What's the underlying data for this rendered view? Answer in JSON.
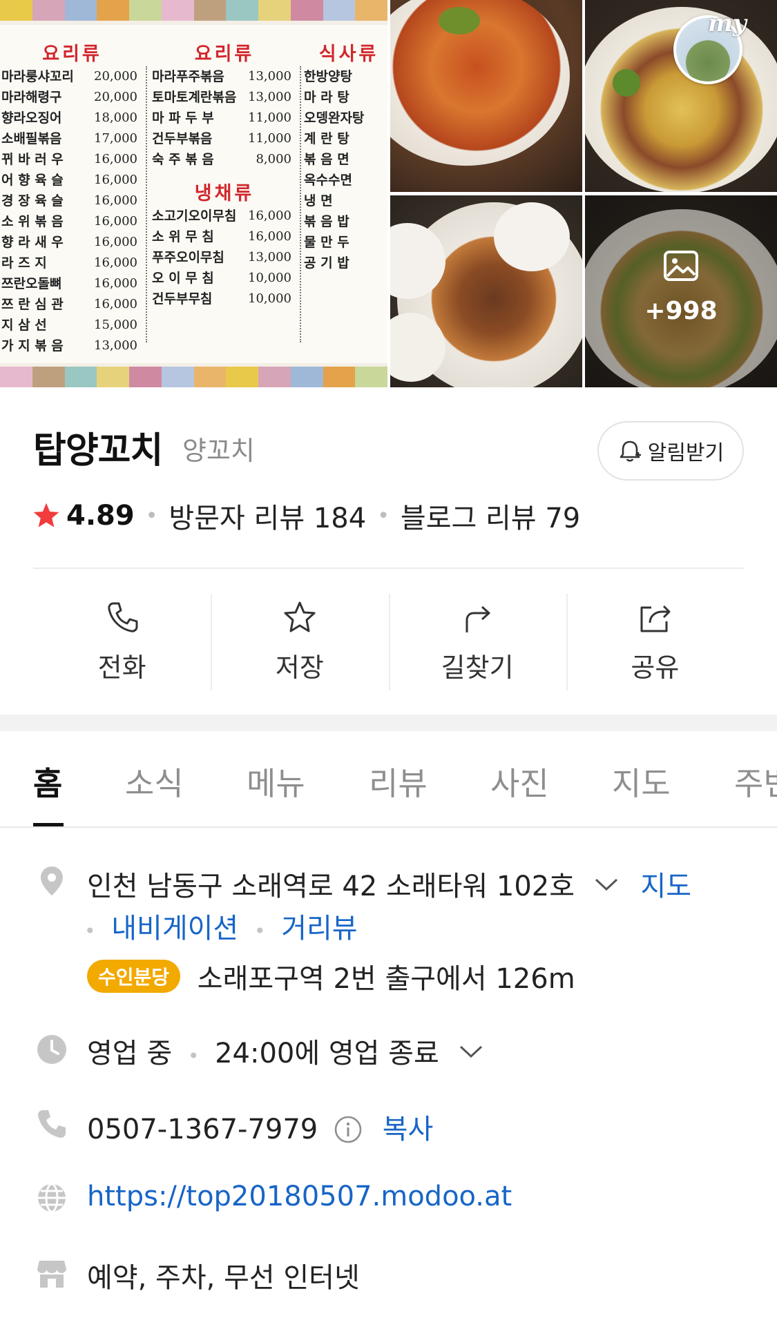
{
  "gallery": {
    "menu_board": {
      "colors": [
        "#e8c94a",
        "#d6a5b8",
        "#9fb8d8",
        "#e4a34a",
        "#c9d79a",
        "#e7b9cf",
        "#bfa07e",
        "#9ac7c2",
        "#e6d27a",
        "#cf8aa2",
        "#b7c6e0",
        "#e9b56a"
      ],
      "columns": [
        {
          "sections": [
            {
              "heading": "요리류",
              "items": [
                {
                  "name": "마라룽샤꼬리",
                  "price": "20,000"
                },
                {
                  "name": "마라해령구",
                  "price": "20,000"
                },
                {
                  "name": "향라오징어",
                  "price": "18,000"
                },
                {
                  "name": "소배필볶음",
                  "price": "17,000"
                },
                {
                  "name": "뀌 바 러 우",
                  "price": "16,000"
                },
                {
                  "name": "어 향 육 슬",
                  "price": "16,000"
                },
                {
                  "name": "경 장 육 슬",
                  "price": "16,000"
                },
                {
                  "name": "소 위 볶 음",
                  "price": "16,000"
                },
                {
                  "name": "향 라 새 우",
                  "price": "16,000"
                },
                {
                  "name": "라 즈 지",
                  "price": "16,000"
                },
                {
                  "name": "쯔란오돌뼈",
                  "price": "16,000"
                },
                {
                  "name": "쯔 란 심 관",
                  "price": "16,000"
                },
                {
                  "name": "지 삼 선",
                  "price": "15,000"
                },
                {
                  "name": "가 지 볶 음",
                  "price": "13,000"
                }
              ]
            }
          ]
        },
        {
          "sections": [
            {
              "heading": "요리류",
              "items": [
                {
                  "name": "마라푸주볶음",
                  "price": "13,000"
                },
                {
                  "name": "토마토계란볶음",
                  "price": "13,000"
                },
                {
                  "name": "마 파 두 부",
                  "price": "11,000"
                },
                {
                  "name": "건두부볶음",
                  "price": "11,000"
                },
                {
                  "name": "숙 주 볶 음",
                  "price": "8,000"
                }
              ]
            },
            {
              "heading": "냉채류",
              "items": [
                {
                  "name": "소고기오이무침",
                  "price": "16,000"
                },
                {
                  "name": "소 위 무 침",
                  "price": "16,000"
                },
                {
                  "name": "푸주오이무침",
                  "price": "13,000"
                },
                {
                  "name": "오 이 무 침",
                  "price": "10,000"
                },
                {
                  "name": "건두부무침",
                  "price": "10,000"
                }
              ]
            }
          ]
        },
        {
          "sections": [
            {
              "heading": "식사류",
              "items": [
                {
                  "name": "한방양탕",
                  "price": ""
                },
                {
                  "name": "마 라 탕",
                  "price": ""
                },
                {
                  "name": "오뎅완자탕",
                  "price": ""
                },
                {
                  "name": "계 란 탕",
                  "price": ""
                },
                {
                  "name": "볶 음 면",
                  "price": ""
                },
                {
                  "name": "옥수수면",
                  "price": ""
                },
                {
                  "name": "냉 면",
                  "price": ""
                },
                {
                  "name": "볶 음 밥",
                  "price": ""
                },
                {
                  "name": "물 만 두",
                  "price": ""
                },
                {
                  "name": "공 기 밥",
                  "price": ""
                }
              ]
            }
          ]
        }
      ]
    },
    "my_label": "my",
    "more_count": "+998",
    "more_icon": "image-icon"
  },
  "place": {
    "name": "탑양꼬치",
    "category": "양꼬치",
    "notify_label": "알림받기",
    "notify_icon": "bell-plus-icon",
    "rating": "4.89",
    "visitor_reviews": "방문자 리뷰 184",
    "blog_reviews": "블로그 리뷰 79",
    "star_color": "#f03c3c"
  },
  "actions": [
    {
      "label": "전화",
      "icon": "phone-icon"
    },
    {
      "label": "저장",
      "icon": "star-outline-icon"
    },
    {
      "label": "길찾기",
      "icon": "directions-icon"
    },
    {
      "label": "공유",
      "icon": "share-icon"
    }
  ],
  "tabs": [
    "홈",
    "소식",
    "메뉴",
    "리뷰",
    "사진",
    "지도",
    "주변"
  ],
  "info": {
    "address": "인천 남동구 소래역로 42 소래타워 102호",
    "map_link": "지도",
    "navigation_link": "내비게이션",
    "street_view_link": "거리뷰",
    "station_badge": "수인분당",
    "station_text": "소래포구역 2번 출구에서 126m",
    "status": "영업 중",
    "hours": "24:00에 영업 종료",
    "phone": "0507-1367-7979",
    "copy_label": "복사",
    "website": "https://top20180507.modoo.at",
    "amenities": "예약, 주차, 무선 인터넷",
    "link_color": "#1765c7",
    "badge_color": "#f2a900"
  }
}
